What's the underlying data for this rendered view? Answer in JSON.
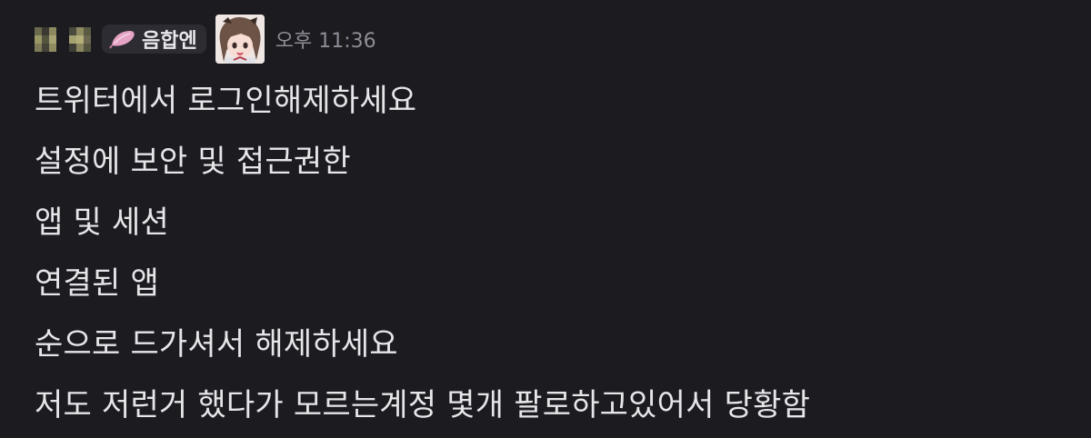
{
  "message": {
    "author": {
      "role_tag": {
        "label": "음합엔",
        "icon": "pink-petal-icon",
        "color": "#e6a4c4"
      },
      "avatar": "anime-character-avatar"
    },
    "timestamp": "오후 11:36",
    "lines": [
      "트위터에서 로그인해제하세요",
      "설정에 보안 및 접근권한",
      "앱 및 세션",
      "연결된 앱",
      "순으로 드가셔서 해제하세요",
      "저도 저런거 했다가 모르는계정 몇개 팔로하고있어서 당황함"
    ]
  },
  "colors": {
    "background": "#1c1b20",
    "text": "#e6e6e9",
    "muted": "#8d8d95",
    "tag_background": "#2d2c33"
  }
}
